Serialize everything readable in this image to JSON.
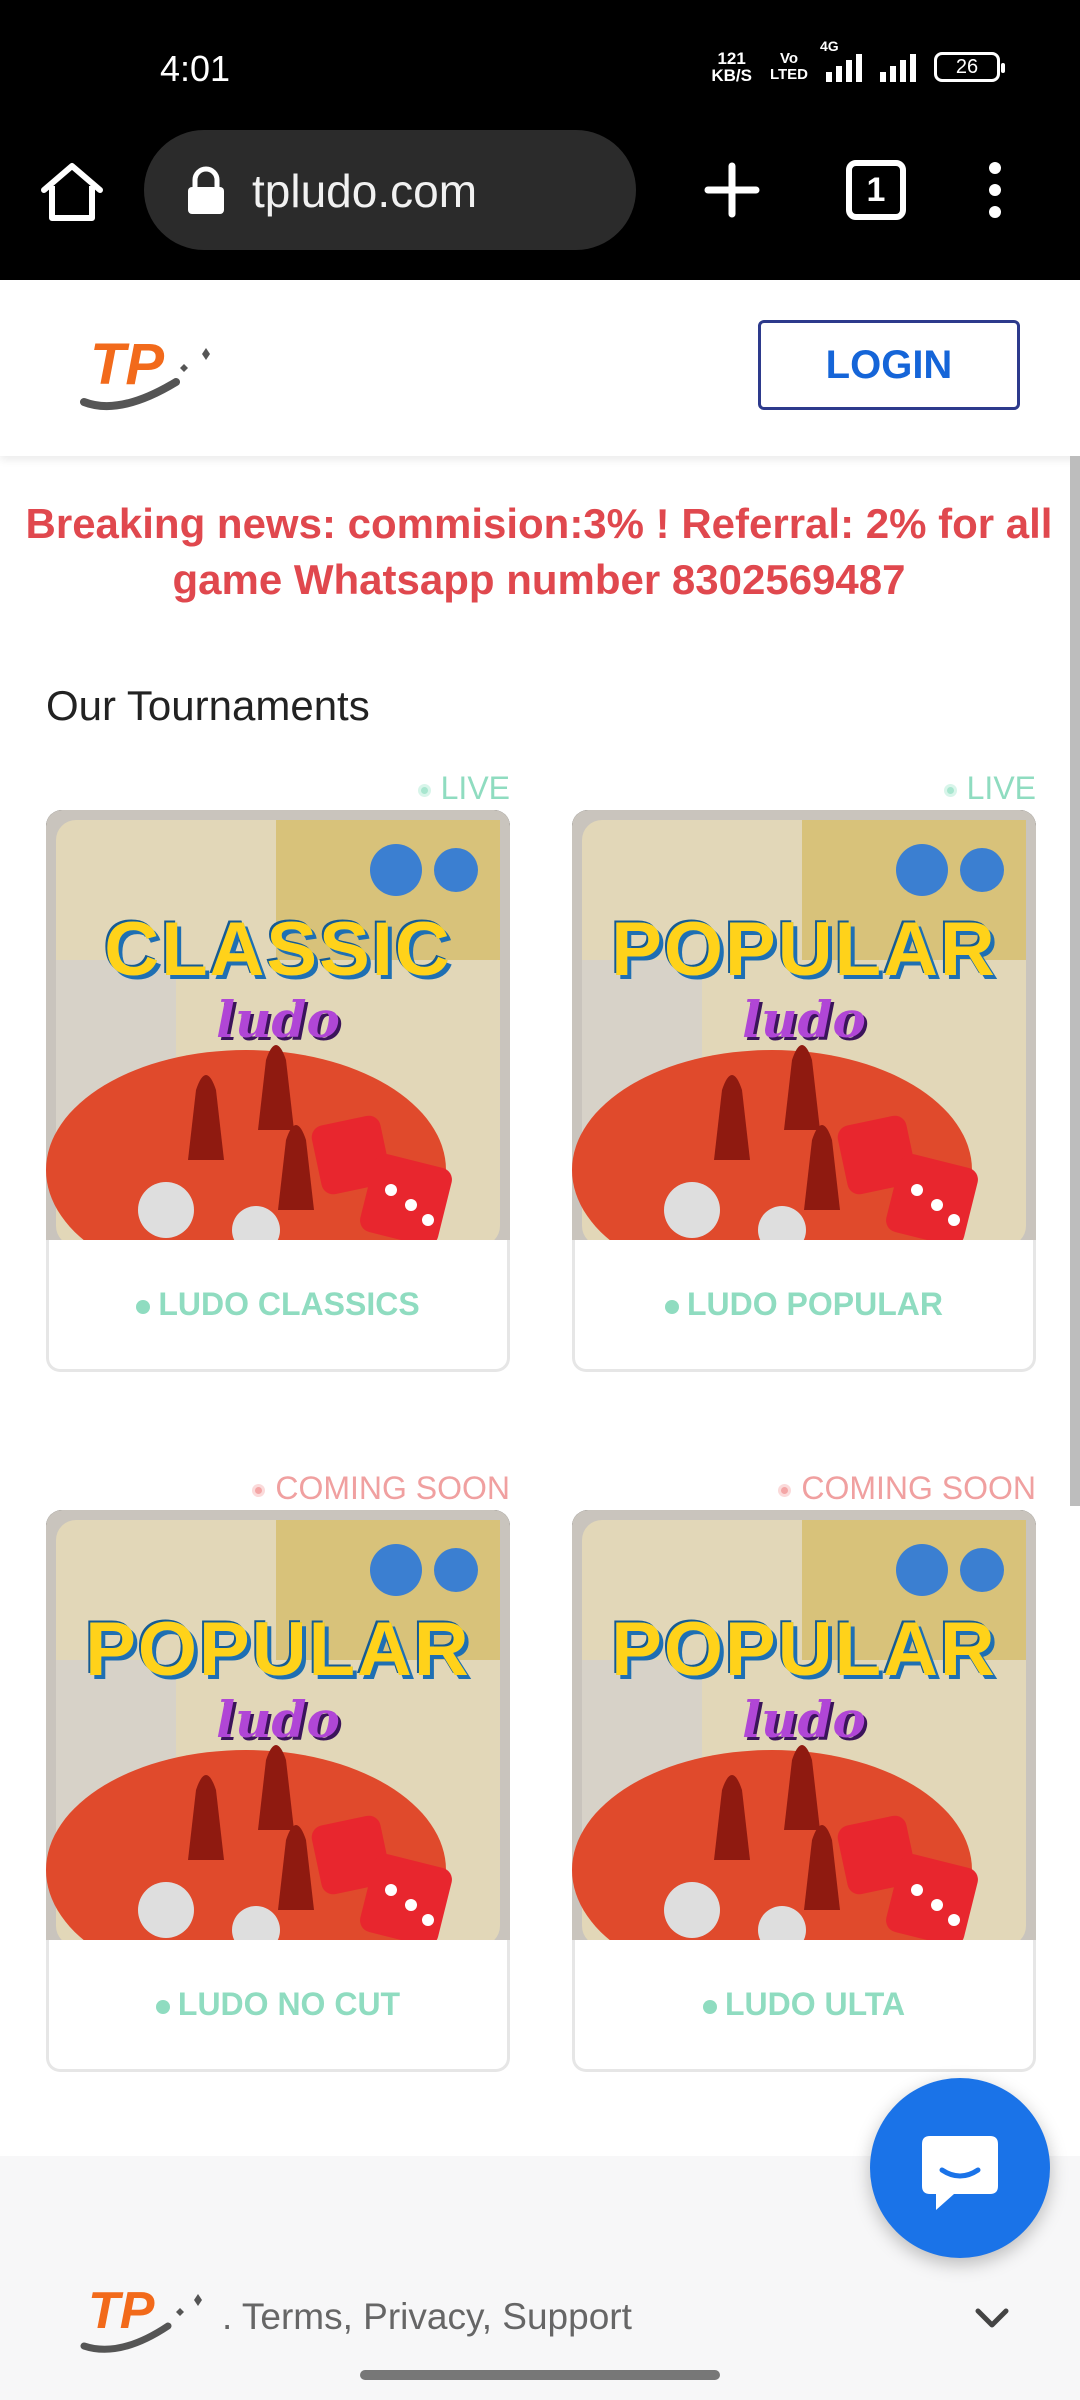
{
  "status_bar": {
    "time": "4:01",
    "net_speed_value": "121",
    "net_speed_unit": "KB/S",
    "volte_top": "Vo",
    "volte_bottom": "LTED",
    "network_type": "4G",
    "battery": "26"
  },
  "browser": {
    "url": "tpludo.com",
    "tab_count": "1"
  },
  "header": {
    "logo_text": "TP",
    "login_label": "LOGIN"
  },
  "news": {
    "text": "Breaking news: commision:3% ! Referral: 2% for all game Whatsapp number 8302569487"
  },
  "tournaments": {
    "title": "Our Tournaments",
    "cards": [
      {
        "status": "LIVE",
        "art_title": "CLASSIC",
        "art_sub": "ludo",
        "name": "LUDO CLASSICS"
      },
      {
        "status": "LIVE",
        "art_title": "POPULAR",
        "art_sub": "ludo",
        "name": "LUDO POPULAR"
      },
      {
        "status": "COMING SOON",
        "art_title": "POPULAR",
        "art_sub": "ludo",
        "name": "LUDO NO CUT"
      },
      {
        "status": "COMING SOON",
        "art_title": "POPULAR",
        "art_sub": "ludo",
        "name": "LUDO ULTA"
      }
    ]
  },
  "footer": {
    "links_text": ". Terms, Privacy, Support"
  },
  "colors": {
    "accent_blue": "#1a73e8",
    "news_red": "#e0484e",
    "live_green": "#8fdcc0",
    "soon_pink": "#f0a0a0"
  },
  "icons": [
    "home-icon",
    "lock-icon",
    "plus-icon",
    "tabs-icon",
    "more-vert-icon",
    "chat-icon",
    "chevron-down-icon"
  ]
}
